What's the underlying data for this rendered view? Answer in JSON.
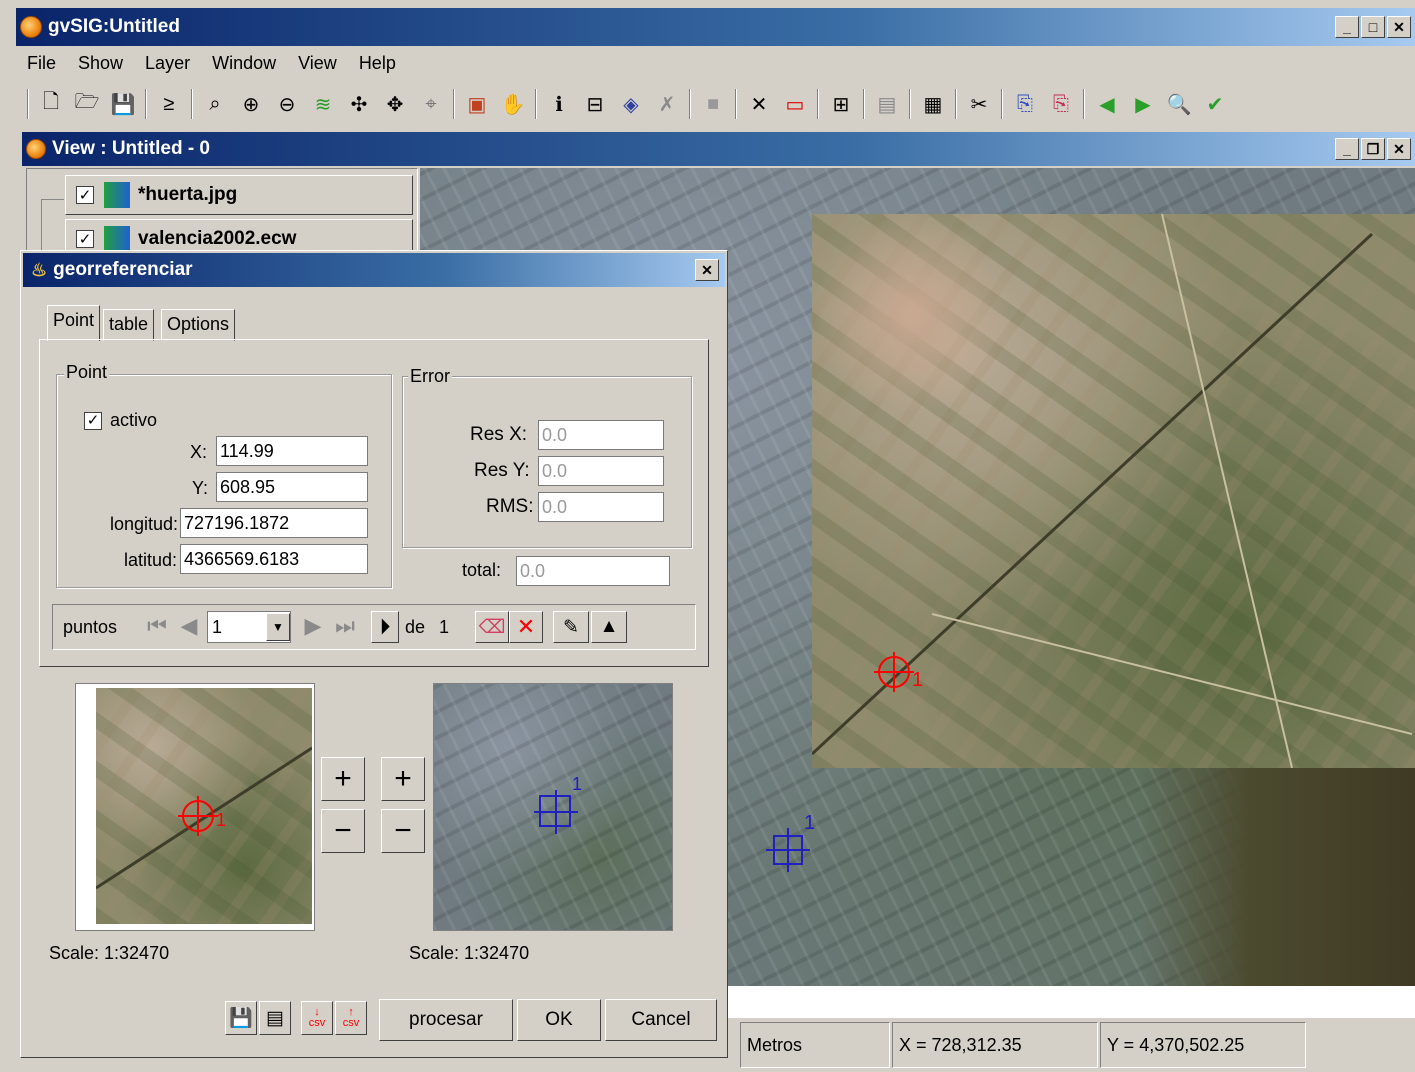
{
  "app": {
    "title": "gvSIG:Untitled"
  },
  "menu": [
    "File",
    "Show",
    "Layer",
    "Window",
    "View",
    "Help"
  ],
  "toolbar": {
    "icons": [
      "new-doc-icon",
      "open-folder-icon",
      "save-icon",
      "add-layer-icon",
      "zoom-prev-icon",
      "zoom-in-icon",
      "zoom-out-icon",
      "layers-icon",
      "zoom-all-icon",
      "zoom-extent-icon",
      "zoom-select-icon",
      "raster-icon",
      "pan-hand-icon",
      "info-icon",
      "measure-icon",
      "area-icon",
      "pin-icon",
      "gray-box-icon",
      "expand-icon",
      "red-rect-icon",
      "add-frame-icon",
      "table-icon",
      "grid-icon",
      "tools-icon",
      "copy-doc-icon",
      "paste-doc-icon",
      "green-left-icon",
      "green-right-icon",
      "search-gray-icon",
      "checkmark-icon"
    ]
  },
  "view": {
    "title": "View : Untitled - 0",
    "layers": [
      {
        "name": "*huerta.jpg",
        "checked": true
      },
      {
        "name": "valencia2002.ecw",
        "checked": true
      }
    ]
  },
  "dialog": {
    "title": "georreferenciar",
    "tabs": [
      "Point",
      "table",
      "Options"
    ],
    "point_group": {
      "legend": "Point",
      "activo_label": "activo",
      "x_label": "X:",
      "x_value": "114.99",
      "y_label": "Y:",
      "y_value": "608.95",
      "lon_label": "longitud:",
      "lon_value": "727196.1872",
      "lat_label": "latitud:",
      "lat_value": "4366569.6183"
    },
    "error_group": {
      "legend": "Error",
      "resx_label": "Res X:",
      "resx_value": "0.0",
      "resy_label": "Res Y:",
      "resy_value": "0.0",
      "rms_label": "RMS:",
      "rms_value": "0.0"
    },
    "total_label": "total:",
    "total_value": "0.0",
    "puntos_label": "puntos",
    "point_index": "1",
    "de_label": "de",
    "de_count": "1",
    "zoom_plus": "+",
    "zoom_minus": "−",
    "scale_left": "Scale: 1:32470",
    "scale_right": "Scale: 1:32470",
    "marker_label": "1",
    "csv_label": "csv",
    "buttons": {
      "procesar": "procesar",
      "ok": "OK",
      "cancel": "Cancel"
    }
  },
  "status": {
    "units": "Metros",
    "x": "X = 728,312.35",
    "y": "Y = 4,370,502.25"
  },
  "colors": {
    "title_start": "#0a246a",
    "title_end": "#a6caf0",
    "marker_red": "#ff0000",
    "marker_blue": "#2020c0"
  }
}
